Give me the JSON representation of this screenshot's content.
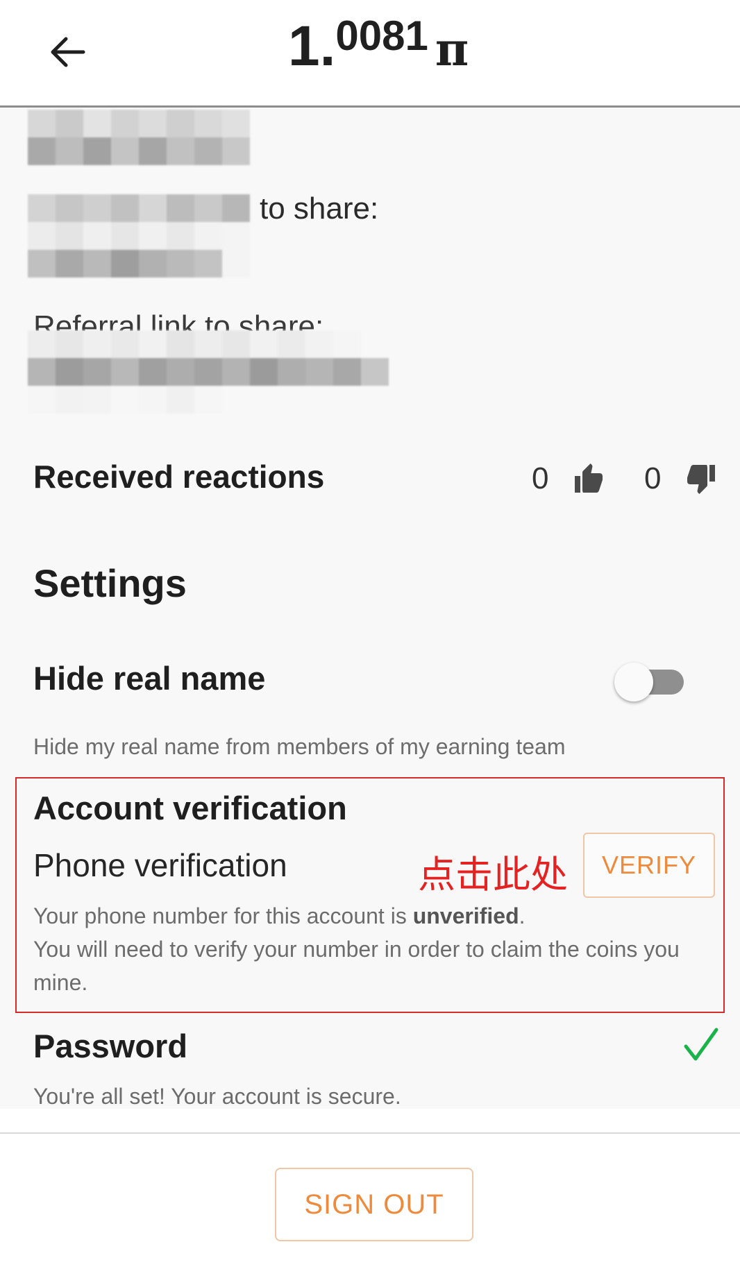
{
  "header": {
    "balance_integer": "1",
    "balance_separator": ".",
    "balance_fraction": "0081",
    "currency_symbol": "π",
    "back_icon": "arrow-left-icon"
  },
  "share": {
    "invite_label_visible": "to share:",
    "referral_label_partial": "Referral link to share:"
  },
  "reactions": {
    "title": "Received reactions",
    "likes_count": "0",
    "dislikes_count": "0",
    "like_icon": "thumbs-up-icon",
    "dislike_icon": "thumbs-down-icon"
  },
  "settings": {
    "title": "Settings",
    "hide_real_name": {
      "label": "Hide real name",
      "description": "Hide my real name from members of my earning team",
      "enabled": false
    }
  },
  "account_verification": {
    "title": "Account verification",
    "phone_label": "Phone verification",
    "annotation": "点击此处",
    "verify_button": "VERIFY",
    "desc_prefix": "Your phone number for this account is ",
    "desc_status": "unverified",
    "desc_period": ".",
    "desc_line2": "You will need to verify your number in order to claim the coins you mine.",
    "annotation_color": "#e52222"
  },
  "password": {
    "title": "Password",
    "description": "You're all set! Your account is secure.",
    "status_icon": "checkmark-icon",
    "status_color": "#19b34a"
  },
  "footer": {
    "sign_out_label": "SIGN OUT"
  },
  "colors": {
    "accent": "#ee8a3c",
    "accent_border": "#f0c7a6",
    "highlight_border": "#d42a2a"
  }
}
